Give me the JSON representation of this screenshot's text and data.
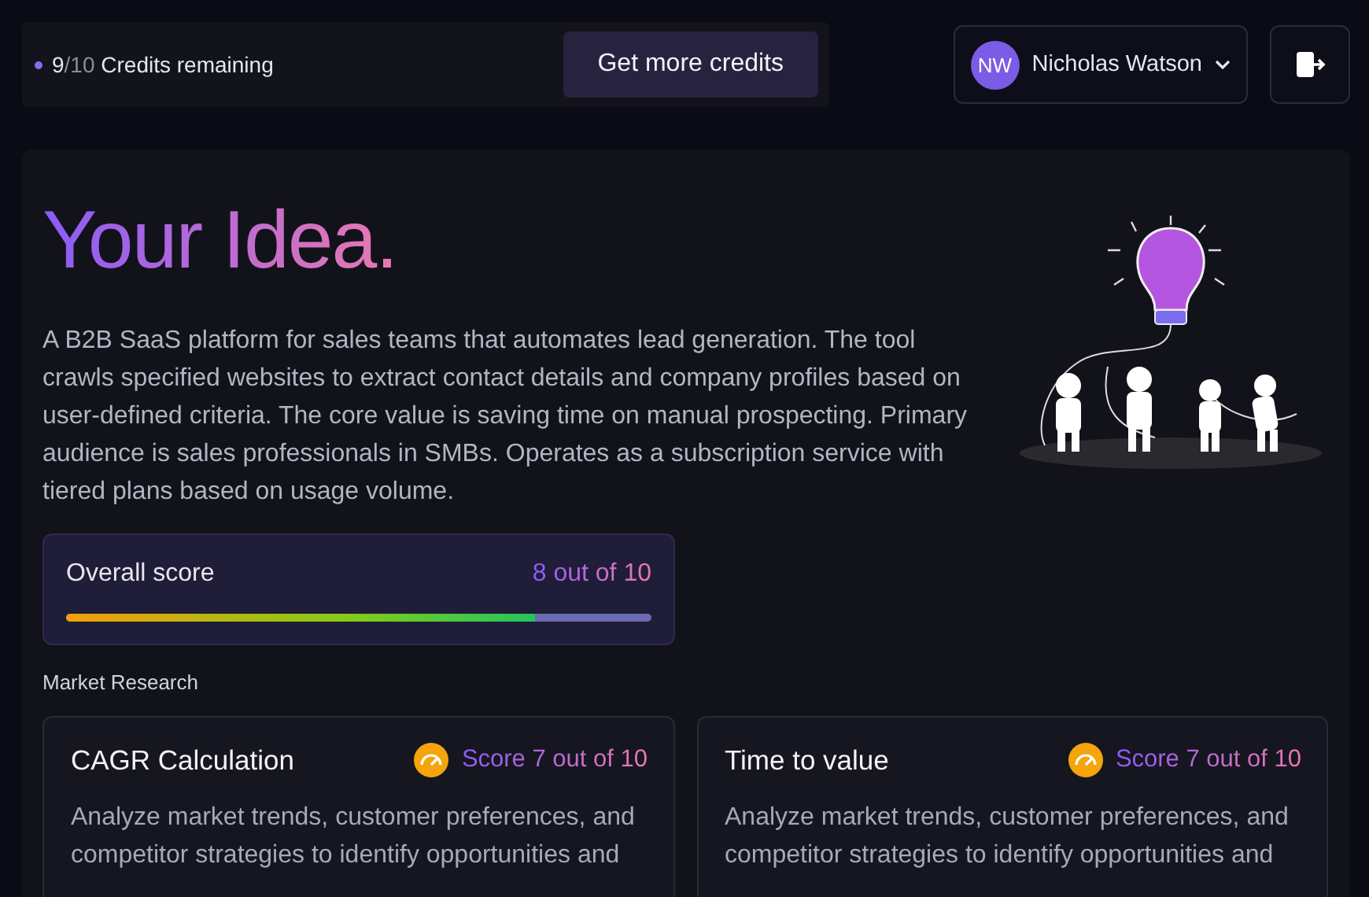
{
  "credits": {
    "used": "9",
    "total": "/10",
    "label": "Credits remaining",
    "button": "Get more credits"
  },
  "user": {
    "initials": "NW",
    "name": "Nicholas Watson"
  },
  "idea": {
    "title": "Your Idea.",
    "description": "A B2B SaaS platform for sales teams that automates lead generation. The tool crawls specified websites to extract contact details and company profiles based on user-defined criteria. The core value is saving time on manual prospecting. Primary audience is sales professionals in SMBs. Operates as a subscription service with tiered plans based on usage volume."
  },
  "overall_score": {
    "label": "Overall score",
    "reading": "8 out of 10",
    "level": 0.8
  },
  "section_title": "Market Research",
  "research_cards": [
    {
      "title": "CAGR Calculation",
      "score": "Score 7 out of 10",
      "description": "Analyze market trends, customer preferences, and competitor strategies to identify opportunities and"
    },
    {
      "title": "Time to value",
      "score": "Score 7 out of 10",
      "description": "Analyze market trends, customer preferences, and competitor strategies to identify opportunities and"
    }
  ]
}
